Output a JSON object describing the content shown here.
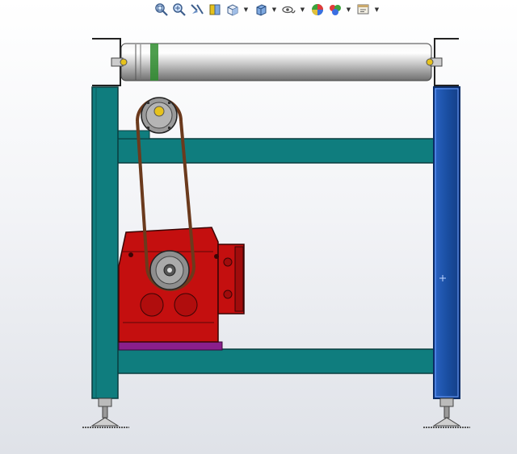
{
  "window": {
    "title": "",
    "background_colors": [
      "#ffffff",
      "#dfe2e8"
    ]
  },
  "toolbar": {
    "buttons": [
      {
        "icon": "zoom-to-fit-icon",
        "has_dropdown": false
      },
      {
        "icon": "zoom-to-area-icon",
        "has_dropdown": false
      },
      {
        "icon": "previous-view-icon",
        "has_dropdown": false
      },
      {
        "icon": "section-view-icon",
        "has_dropdown": false
      },
      {
        "icon": "view-orientation-icon",
        "has_dropdown": true
      },
      {
        "icon": "display-style-icon",
        "has_dropdown": true
      },
      {
        "icon": "hide-show-items-icon",
        "has_dropdown": true
      },
      {
        "icon": "edit-appearance-icon",
        "has_dropdown": false
      },
      {
        "icon": "apply-scene-icon",
        "has_dropdown": true
      },
      {
        "icon": "view-settings-icon",
        "has_dropdown": true
      }
    ]
  },
  "model": {
    "components": [
      "roller",
      "frame-left-leg",
      "frame-right-leg-selected",
      "upper-crossbar",
      "lower-crossbar",
      "motor-gearbox",
      "drive-belt",
      "driven-sprocket",
      "drive-sprocket",
      "leveling-feet"
    ],
    "colors": {
      "frame": "#0f7d7e",
      "frame_selected": "#1a4fa3",
      "roller": "#dadada",
      "gearbox": "#c40f0f",
      "gearbox_base": "#8a1f8c",
      "belt": "#6b3a1d",
      "sprocket": "#9a9a9a",
      "sprocket_hub": "#e6c21c",
      "belt_clip": "#2f8d2f"
    }
  }
}
